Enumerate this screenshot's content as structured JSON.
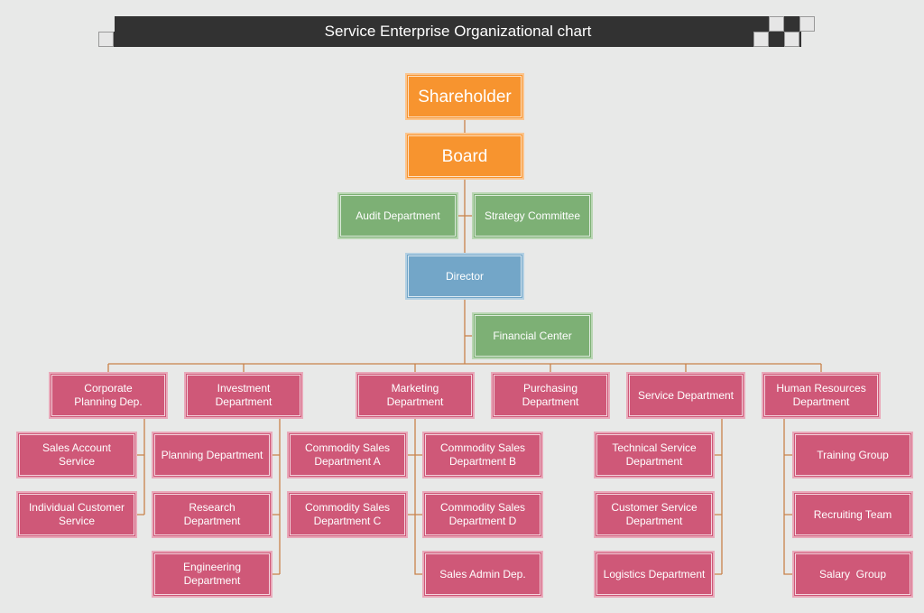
{
  "title": "Service Enterprise Organizational chart",
  "colors": {
    "background": "#e8e9e8",
    "title_bar": "#323232",
    "connector": "#c8834a",
    "executive": "#f7942f",
    "committee": "#7db075",
    "director": "#73a6c8",
    "department": "#cf5878"
  },
  "nodes": {
    "shareholder": "Shareholder",
    "board": "Board",
    "audit": "Audit Department",
    "strategy": "Strategy Committee",
    "director": "Director",
    "financial": "Financial Center",
    "corporate_planning": "Corporate\nPlanning Dep.",
    "investment": "Investment\nDepartment",
    "marketing": "Marketing\nDepartment",
    "purchasing": "Purchasing\nDepartment",
    "service": "Service Department",
    "hr": "Human Resources\nDepartment",
    "sales_account": "Sales Account\nService",
    "individual_customer": "Individual Customer\nService",
    "planning": "Planning Department",
    "research": "Research\nDepartment",
    "engineering": "Engineering\nDepartment",
    "commodity_a": "Commodity Sales\nDepartment A",
    "commodity_b": "Commodity Sales\nDepartment B",
    "commodity_c": "Commodity Sales\nDepartment C",
    "commodity_d": "Commodity Sales\nDepartment D",
    "sales_admin": "Sales Admin Dep.",
    "technical_service": "Technical Service\nDepartment",
    "customer_service": "Customer Service\nDepartment",
    "logistics": "Logistics Department",
    "training": "Training Group",
    "recruiting": "Recruiting Team",
    "salary": "Salary  Group"
  }
}
